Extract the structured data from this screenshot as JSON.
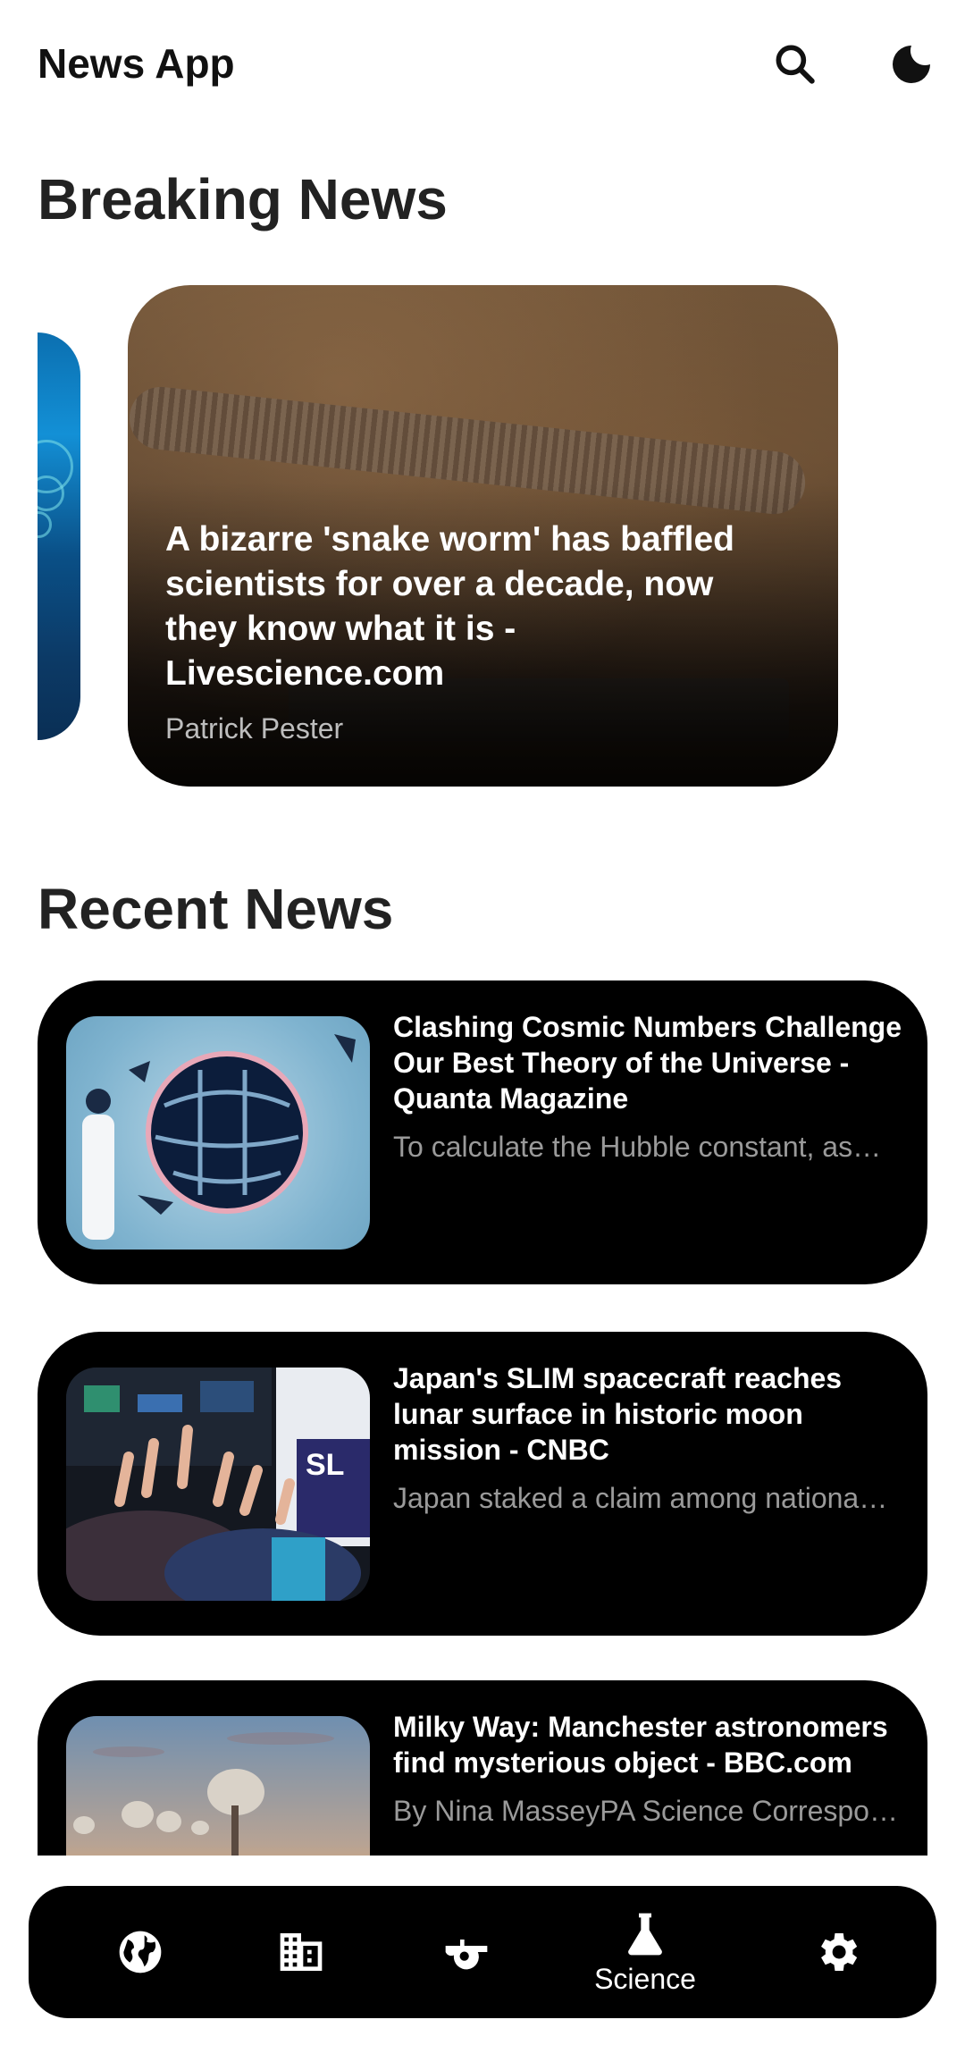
{
  "header": {
    "title": "News App",
    "search_icon": "search-icon",
    "theme_icon": "moon-icon"
  },
  "sections": {
    "breaking": "Breaking News",
    "recent": "Recent News"
  },
  "breaking_news": {
    "title": "A bizarre 'snake worm' has baffled scientists for over a decade, now they know what it is - Livescience.com",
    "author": "Patrick Pester"
  },
  "recent_news": [
    {
      "title": "Clashing Cosmic Numbers Challenge Our Best Theory of the Universe - Quanta Magazine",
      "description": "To calculate the Hubble constant, as…"
    },
    {
      "title": "Japan's SLIM spacecraft reaches lunar surface in historic moon mission - CNBC",
      "description": "Japan staked a claim among nationa…"
    },
    {
      "title": "Milky Way: Manchester astronomers find mysterious object - BBC.com",
      "description": "By Nina MasseyPA Science Correspo…"
    }
  ],
  "bottom_nav": {
    "items": [
      {
        "icon": "globe-icon"
      },
      {
        "icon": "building-icon"
      },
      {
        "icon": "whistle-icon"
      },
      {
        "icon": "flask-icon",
        "label": "Science",
        "active": true
      },
      {
        "icon": "gear-icon"
      }
    ]
  },
  "colors": {
    "background": "#ffffff",
    "card": "#000000",
    "text_primary": "#111111",
    "text_secondary": "#9a9a9a"
  }
}
